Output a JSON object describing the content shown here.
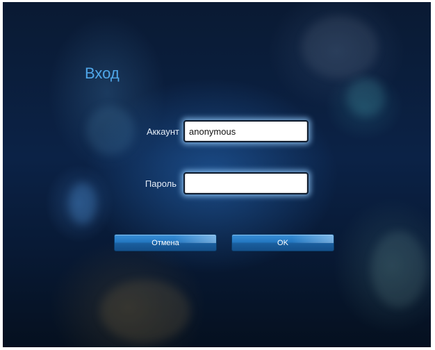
{
  "dialog": {
    "title": "Вход",
    "account_label": "Аккаунт",
    "account_value": "anonymous",
    "password_label": "Пароль",
    "password_value": "",
    "cancel_label": "Отмена",
    "ok_label": "OK"
  },
  "colors": {
    "title": "#4fa6e8",
    "button": "#2478c2",
    "background": "#0b2246"
  }
}
